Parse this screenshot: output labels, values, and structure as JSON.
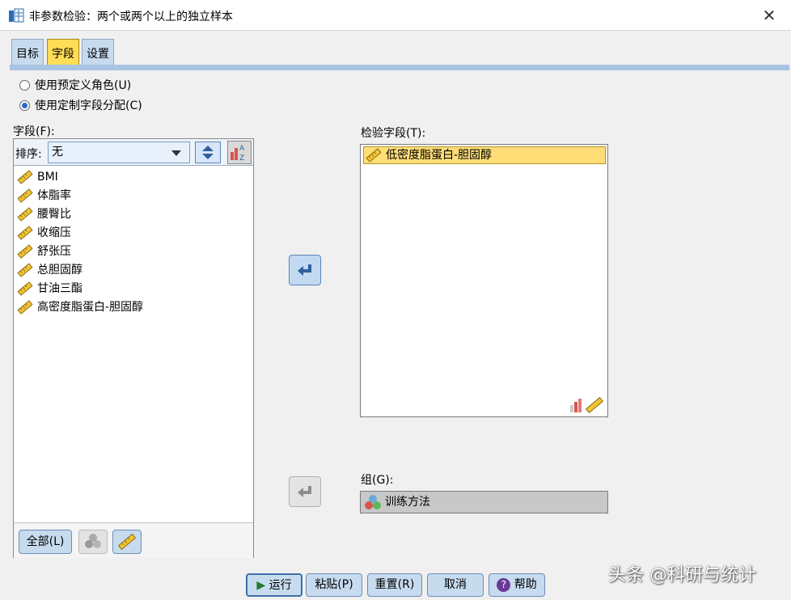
{
  "window": {
    "title": "非参数检验：两个或两个以上的独立样本",
    "close_symbol": "✕"
  },
  "tabs": [
    {
      "label": "目标",
      "active": false
    },
    {
      "label": "字段",
      "active": true
    },
    {
      "label": "设置",
      "active": false
    }
  ],
  "roles": {
    "predefined_label": "使用预定义角色(U)",
    "predefined_selected": false,
    "custom_label": "使用定制字段分配(C)",
    "custom_selected": true
  },
  "fields_panel": {
    "label": "字段(F):",
    "sort_label": "排序:",
    "sort_value": "无",
    "items": [
      {
        "label": "BMI",
        "icon": "scale-ruler-icon"
      },
      {
        "label": "体脂率",
        "icon": "scale-ruler-icon"
      },
      {
        "label": "腰臀比",
        "icon": "scale-ruler-icon"
      },
      {
        "label": "收缩压",
        "icon": "scale-ruler-icon"
      },
      {
        "label": "舒张压",
        "icon": "scale-ruler-icon"
      },
      {
        "label": "总胆固醇",
        "icon": "scale-ruler-icon"
      },
      {
        "label": "甘油三酯",
        "icon": "scale-ruler-icon"
      },
      {
        "label": "高密度脂蛋白-胆固醇",
        "icon": "scale-ruler-icon"
      }
    ],
    "all_button": "全部(L)"
  },
  "test_fields": {
    "label": "检验字段(T):",
    "items": [
      {
        "label": "低密度脂蛋白-胆固醇",
        "icon": "scale-ruler-icon",
        "selected": true
      }
    ]
  },
  "group": {
    "label": "组(G):",
    "value": "训练方法",
    "icon": "nominal-circles-icon"
  },
  "footer": {
    "run": "运行",
    "paste": "粘贴(P)",
    "reset": "重置(R)",
    "cancel": "取消",
    "help": "帮助"
  },
  "watermark": "头条 @科研与统计",
  "colors": {
    "tab_active": "#ffdd55",
    "tab_inactive": "#c7dbef",
    "selected_item": "#ffdd77",
    "button_fill": "#c7dbef"
  }
}
